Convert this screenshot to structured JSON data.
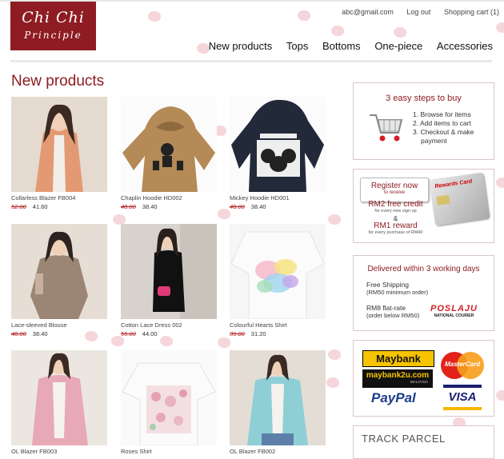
{
  "header": {
    "logo_line1": "Chi Chi",
    "logo_line2": "Principle",
    "email": "abc@gmail.com",
    "logout": "Log out",
    "cart": "Shopping cart (1)"
  },
  "nav": {
    "items": [
      "New products",
      "Tops",
      "Bottoms",
      "One-piece",
      "Accessories"
    ]
  },
  "main": {
    "title": "New products",
    "products": [
      {
        "name": "Collarless Blazer FB004",
        "old_price": "52.00",
        "price": "41.60"
      },
      {
        "name": "Chaplin Hoodie HD002",
        "old_price": "48.00",
        "price": "38.40"
      },
      {
        "name": "Mickey Hoodie HD001",
        "old_price": "48.00",
        "price": "38.40"
      },
      {
        "name": "Lace-sleeved Blouse",
        "old_price": "48.00",
        "price": "38.40"
      },
      {
        "name": "Cotton Lace Dress 002",
        "old_price": "55.00",
        "price": "44.00"
      },
      {
        "name": "Colourful Hearts Shirt",
        "old_price": "39.00",
        "price": "31.20"
      },
      {
        "name": "OL Blazer FB003",
        "old_price": "",
        "price": ""
      },
      {
        "name": "Roses Shirt",
        "old_price": "",
        "price": ""
      },
      {
        "name": "OL Blazer FB002",
        "old_price": "",
        "price": ""
      }
    ]
  },
  "sidebar": {
    "steps": {
      "title": "3 easy steps to buy",
      "items": [
        "1. Browse for items",
        "2. Add items to cart",
        "3. Checkout & make",
        "    payment"
      ]
    },
    "register": {
      "button": "Register now",
      "button_sub": "to receive",
      "card_text": "Rewards Card",
      "credit": "RM2 free credit",
      "credit_sub": "for every new sign up",
      "amp": "&",
      "reward": "RM1 reward",
      "reward_sub": "for every purchase of RM40"
    },
    "delivery": {
      "title": "Delivered within 3 working days",
      "free": "Free Shipping",
      "free_sub": "(RM50 minimum order)",
      "flat": "RM8 flat-rate",
      "flat_sub": "(order below RM50)",
      "courier": "POSLAJU",
      "courier_sub": "NATIONAL COURIER"
    },
    "payment": {
      "maybank": "Maybank",
      "maybank2u": "maybank2u.com",
      "maybank2u_sub": "MALAYSIA",
      "mastercard": "MasterCard",
      "paypal": "PayPal",
      "visa": "VISA"
    },
    "track": {
      "title": "TRACK PARCEL"
    }
  },
  "colors": {
    "brand": "#8e1c22",
    "price_old": "#b31b1b",
    "petal": "#f3cfd3"
  }
}
